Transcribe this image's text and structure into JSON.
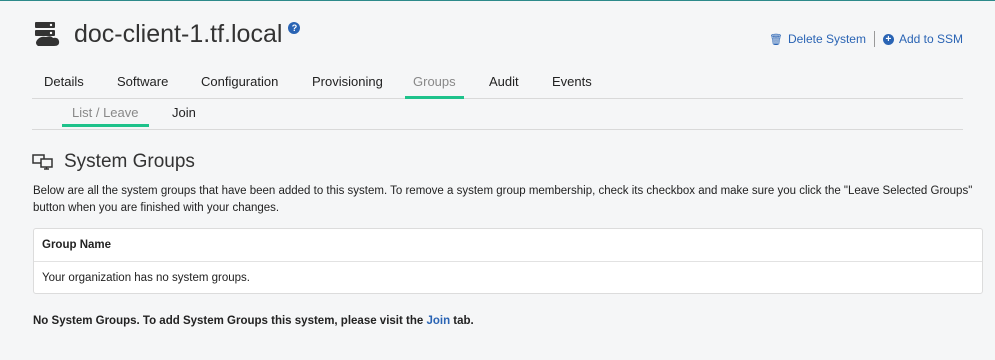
{
  "header": {
    "title": "doc-client-1.tf.local",
    "icon": "server-icon",
    "help_symbol": "?"
  },
  "actions": {
    "delete_label": "Delete System",
    "add_ssm_label": "Add to SSM"
  },
  "tabs": [
    {
      "label": "Details"
    },
    {
      "label": "Software"
    },
    {
      "label": "Configuration"
    },
    {
      "label": "Provisioning"
    },
    {
      "label": "Groups",
      "active": true
    },
    {
      "label": "Audit"
    },
    {
      "label": "Events"
    }
  ],
  "subtabs": [
    {
      "label": "List / Leave",
      "active": true
    },
    {
      "label": "Join"
    }
  ],
  "section": {
    "title": "System Groups",
    "description": "Below are all the system groups that have been added to this system. To remove a system group membership, check its checkbox and make sure you click the \"Leave Selected Groups\" button when you are finished with your changes."
  },
  "table": {
    "header": "Group Name",
    "empty_message": "Your organization has no system groups."
  },
  "footer": {
    "note_prefix": "No System Groups. To add System Groups this system, please visit the ",
    "link_label": "Join",
    "note_suffix": " tab."
  },
  "colors": {
    "accent": "#1ec28b",
    "link": "#2a64b4"
  }
}
